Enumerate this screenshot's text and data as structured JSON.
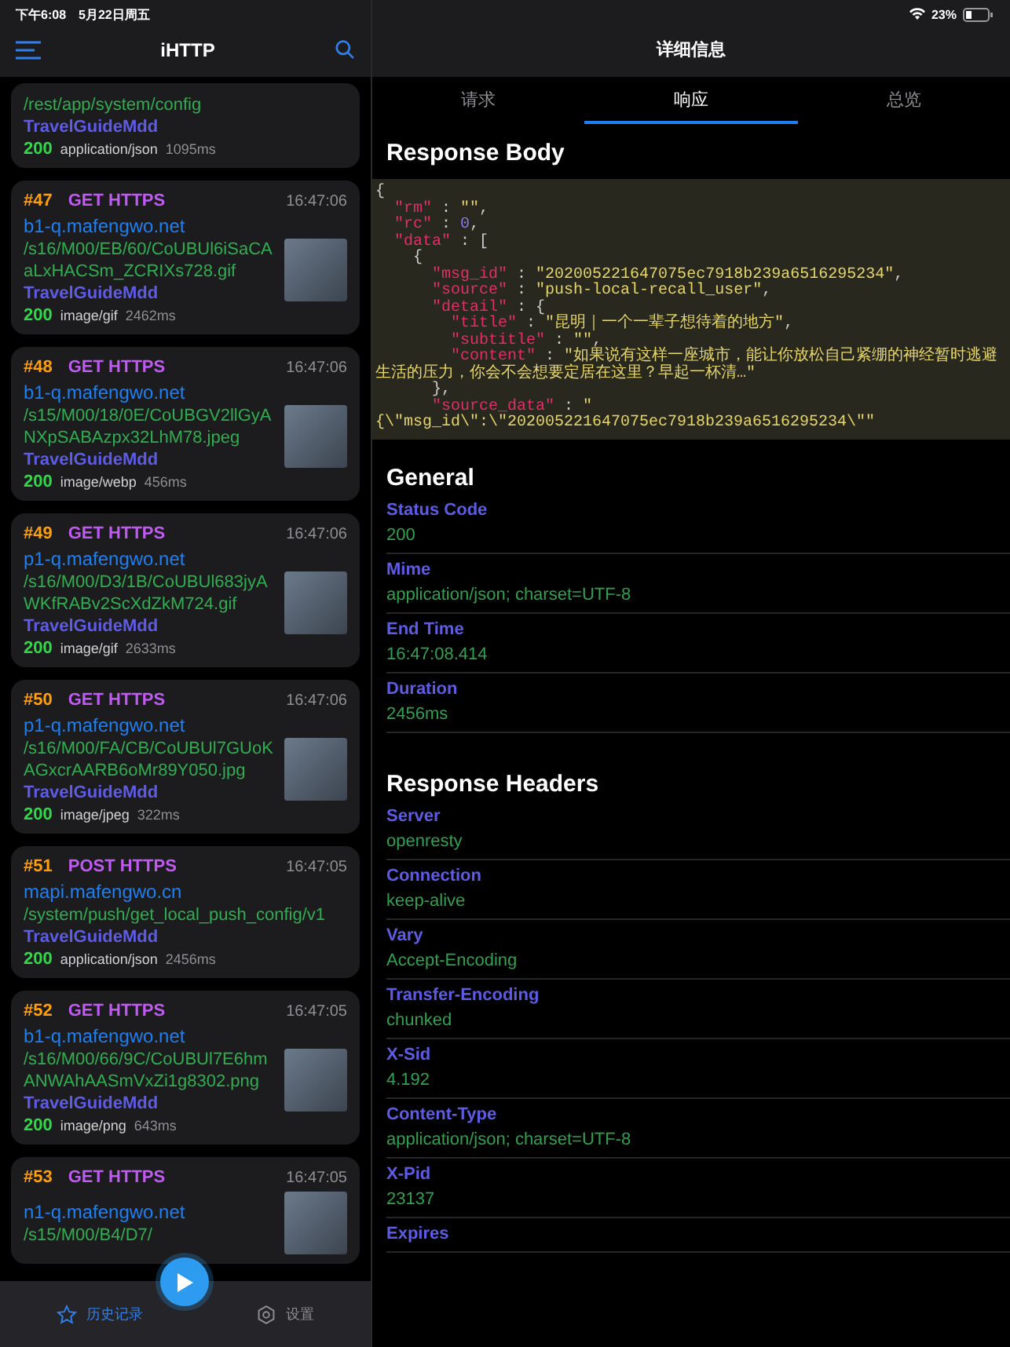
{
  "status_bar": {
    "time": "下午6:08",
    "date": "5月22日周五",
    "battery": "23%"
  },
  "sidebar": {
    "title": "iHTTP",
    "requests": [
      {
        "path": "/rest/app/system/config",
        "app": "TravelGuideMdd",
        "status": "200",
        "mime": "application/json",
        "duration": "1095ms",
        "thumbnail": false
      },
      {
        "number": "#47",
        "method": "GET HTTPS",
        "time": "16:47:06",
        "host": "b1-q.mafengwo.net",
        "path": "/s16/M00/EB/60/CoUBUl6iSaCAaLxHACSm_ZCRIXs728.gif",
        "app": "TravelGuideMdd",
        "status": "200",
        "mime": "image/gif",
        "duration": "2462ms",
        "thumbnail": true
      },
      {
        "number": "#48",
        "method": "GET HTTPS",
        "time": "16:47:06",
        "host": "b1-q.mafengwo.net",
        "path": "/s15/M00/18/0E/CoUBGV2llGyANXpSABAzpx32LhM78.jpeg",
        "app": "TravelGuideMdd",
        "status": "200",
        "mime": "image/webp",
        "duration": "456ms",
        "thumbnail": true
      },
      {
        "number": "#49",
        "method": "GET HTTPS",
        "time": "16:47:06",
        "host": "p1-q.mafengwo.net",
        "path": "/s16/M00/D3/1B/CoUBUl683jyAWKfRABv2ScXdZkM724.gif",
        "app": "TravelGuideMdd",
        "status": "200",
        "mime": "image/gif",
        "duration": "2633ms",
        "thumbnail": true
      },
      {
        "number": "#50",
        "method": "GET HTTPS",
        "time": "16:47:06",
        "host": "p1-q.mafengwo.net",
        "path": "/s16/M00/FA/CB/CoUBUl7GUoKAGxcrAARB6oMr89Y050.jpg",
        "app": "TravelGuideMdd",
        "status": "200",
        "mime": "image/jpeg",
        "duration": "322ms",
        "thumbnail": true
      },
      {
        "number": "#51",
        "method": "POST HTTPS",
        "time": "16:47:05",
        "host": "mapi.mafengwo.cn",
        "path": "/system/push/get_local_push_config/v1",
        "app": "TravelGuideMdd",
        "status": "200",
        "mime": "application/json",
        "duration": "2456ms",
        "thumbnail": false
      },
      {
        "number": "#52",
        "method": "GET HTTPS",
        "time": "16:47:05",
        "host": "b1-q.mafengwo.net",
        "path": "/s16/M00/66/9C/CoUBUl7E6hmANWAhAASmVxZi1g8302.png",
        "app": "TravelGuideMdd",
        "status": "200",
        "mime": "image/png",
        "duration": "643ms",
        "thumbnail": true
      },
      {
        "number": "#53",
        "method": "GET HTTPS",
        "time": "16:47:05",
        "host": "n1-q.mafengwo.net",
        "path": "/s15/M00/B4/D7/",
        "thumbnail": true
      }
    ],
    "tab_bar": [
      {
        "kind": "history",
        "label": "历史记录",
        "selected": true
      },
      {
        "kind": "settings",
        "label": "设置",
        "selected": false
      }
    ]
  },
  "detail": {
    "title": "详细信息",
    "tabs": [
      {
        "label": "请求",
        "selected": false
      },
      {
        "label": "响应",
        "selected": true
      },
      {
        "label": "总览",
        "selected": false
      }
    ],
    "body_title": "Response Body",
    "body_lines": [
      [
        {
          "kind": "punct",
          "text": "{"
        }
      ],
      [
        {
          "kind": "key",
          "text": "  \"rm\""
        },
        {
          "kind": "punct",
          "text": " : "
        },
        {
          "kind": "str",
          "text": "\"\""
        },
        {
          "kind": "punct",
          "text": ","
        }
      ],
      [
        {
          "kind": "key",
          "text": "  \"rc\""
        },
        {
          "kind": "punct",
          "text": " : "
        },
        {
          "kind": "num",
          "text": "0"
        },
        {
          "kind": "punct",
          "text": ","
        }
      ],
      [
        {
          "kind": "key",
          "text": "  \"data\""
        },
        {
          "kind": "punct",
          "text": " : ["
        }
      ],
      [
        {
          "kind": "punct",
          "text": "    {"
        }
      ],
      [
        {
          "kind": "key",
          "text": "      \"msg_id\""
        },
        {
          "kind": "punct",
          "text": " : "
        },
        {
          "kind": "str",
          "text": "\"202005221647075ec7918b239a6516295234\""
        },
        {
          "kind": "punct",
          "text": ","
        }
      ],
      [
        {
          "kind": "key",
          "text": "      \"source\""
        },
        {
          "kind": "punct",
          "text": " : "
        },
        {
          "kind": "str",
          "text": "\"push-local-recall_user\""
        },
        {
          "kind": "punct",
          "text": ","
        }
      ],
      [
        {
          "kind": "key",
          "text": "      \"detail\""
        },
        {
          "kind": "punct",
          "text": " : {"
        }
      ],
      [
        {
          "kind": "key",
          "text": "        \"title\""
        },
        {
          "kind": "punct",
          "text": " : "
        },
        {
          "kind": "str",
          "text": "\"昆明｜一个一辈子想待着的地方\""
        },
        {
          "kind": "punct",
          "text": ","
        }
      ],
      [
        {
          "kind": "key",
          "text": "        \"subtitle\""
        },
        {
          "kind": "punct",
          "text": " : "
        },
        {
          "kind": "str",
          "text": "\"\""
        },
        {
          "kind": "punct",
          "text": ","
        }
      ],
      [
        {
          "kind": "key",
          "text": "        \"content\""
        },
        {
          "kind": "punct",
          "text": " : "
        },
        {
          "kind": "str",
          "text": "\"如果说有这样一座城市，能让你放松自己紧绷的神经暂时逃避生活的压力，你会不会想要定居在这里？早起一杯清…\""
        }
      ],
      [
        {
          "kind": "punct",
          "text": "      },"
        }
      ],
      [
        {
          "kind": "key",
          "text": "      \"source_data\""
        },
        {
          "kind": "punct",
          "text": " : "
        },
        {
          "kind": "str",
          "text": "\"{\\\"msg_id\\\":\\\"202005221647075ec7918b239a6516295234\\\"\""
        }
      ]
    ],
    "sections": [
      {
        "title": "General",
        "fields": [
          {
            "name": "Status Code",
            "value": "200"
          },
          {
            "name": "Mime",
            "value": "application/json; charset=UTF-8"
          },
          {
            "name": "End Time",
            "value": "16:47:08.414"
          },
          {
            "name": "Duration",
            "value": "2456ms"
          }
        ]
      },
      {
        "title": "Response Headers",
        "fields": [
          {
            "name": "Server",
            "value": "openresty"
          },
          {
            "name": "Connection",
            "value": "keep-alive"
          },
          {
            "name": "Vary",
            "value": "Accept-Encoding"
          },
          {
            "name": "Transfer-Encoding",
            "value": "chunked"
          },
          {
            "name": "X-Sid",
            "value": "4.192"
          },
          {
            "name": "Content-Type",
            "value": "application/json; charset=UTF-8"
          },
          {
            "name": "X-Pid",
            "value": "23137"
          },
          {
            "name": "Expires"
          }
        ]
      }
    ]
  }
}
